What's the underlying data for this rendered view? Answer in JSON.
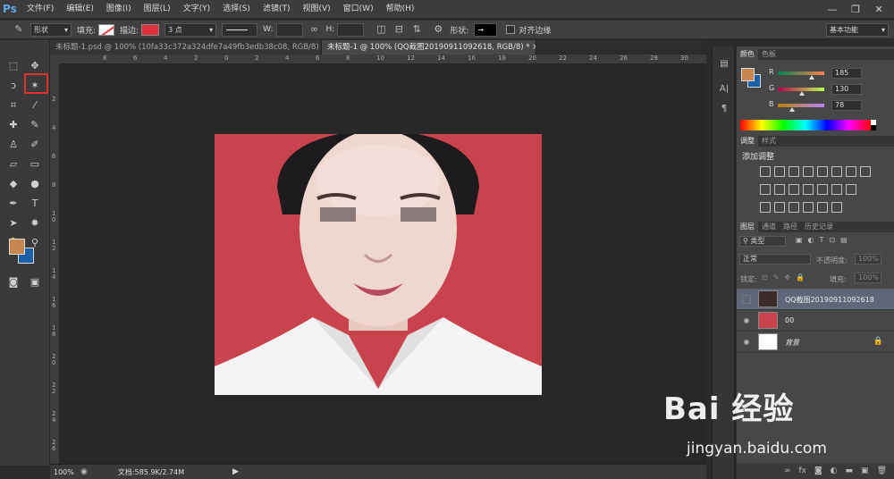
{
  "app": {
    "logo": "Ps",
    "menu": [
      "文件(F)",
      "编辑(E)",
      "图像(I)",
      "图层(L)",
      "文字(Y)",
      "选择(S)",
      "滤镜(T)",
      "视图(V)",
      "窗口(W)",
      "帮助(H)"
    ],
    "window_controls": [
      "—",
      "❐",
      "✕"
    ]
  },
  "options_bar": {
    "mode": "形状",
    "fill_label": "填充:",
    "stroke_label": "描边:",
    "stroke_width": "3 点",
    "w_label": "W:",
    "h_label": "H:",
    "shape_label": "形状:",
    "align_edges_label": "对齐边缘",
    "workspace": "基本功能"
  },
  "tabs": [
    {
      "label": "未标题-1.psd @ 100% (10fa33c372a324dfe7a49fb3edb38c08, RGB/8) *",
      "active": false
    },
    {
      "label": "未标题-1 @ 100% (QQ截图20190911092618, RGB/8) *",
      "active": true
    }
  ],
  "ruler": {
    "top": [
      "8",
      "6",
      "4",
      "2",
      "0",
      "2",
      "4",
      "6",
      "8",
      "10",
      "12",
      "14",
      "16",
      "18",
      "20",
      "22",
      "24",
      "26",
      "28",
      "30",
      "32"
    ],
    "left": [
      "2",
      "4",
      "6",
      "8",
      "1 0",
      "1 2",
      "1 4",
      "1 6",
      "1 8",
      "2 0",
      "2 2",
      "2 4",
      "2 6"
    ]
  },
  "status": {
    "zoom": "100%",
    "doc_info": "文档:585.9K/2.74M"
  },
  "color_panel": {
    "tabs": [
      "颜色",
      "色板"
    ],
    "foreground": "#c8874e",
    "background": "#1b5fa8",
    "channels": [
      {
        "label": "R",
        "value": "185",
        "fraction": 0.725,
        "gradient": "linear-gradient(to right,#008250,#ff8250)"
      },
      {
        "label": "G",
        "value": "130",
        "fraction": 0.51,
        "gradient": "linear-gradient(to right,#b90050,#b9ff50)"
      },
      {
        "label": "B",
        "value": "78",
        "fraction": 0.306,
        "gradient": "linear-gradient(to right,#b98200,#b982ff)"
      }
    ]
  },
  "adjust_panel": {
    "tabs": [
      "调整",
      "样式"
    ],
    "title": "添加调整"
  },
  "layers_panel": {
    "tabs": [
      "图层",
      "通道",
      "路径",
      "历史记录"
    ],
    "filter": "类型",
    "blend_mode": "正常",
    "opacity_label": "不透明度:",
    "opacity_value": "100%",
    "lock_label": "锁定:",
    "fill_label": "填充:",
    "fill_value": "100%",
    "layers": [
      {
        "name": "QQ截图20190911092618",
        "selected": true,
        "visible": false
      },
      {
        "name": "00",
        "selected": false,
        "visible": true
      },
      {
        "name": "背景",
        "selected": false,
        "visible": true,
        "locked": true
      }
    ]
  },
  "watermark": {
    "logo": "Bai 经验",
    "url": "jingyan.baidu.com"
  },
  "colors": {
    "photo_background": "#c9434f",
    "annotation": "#e02f2f"
  }
}
